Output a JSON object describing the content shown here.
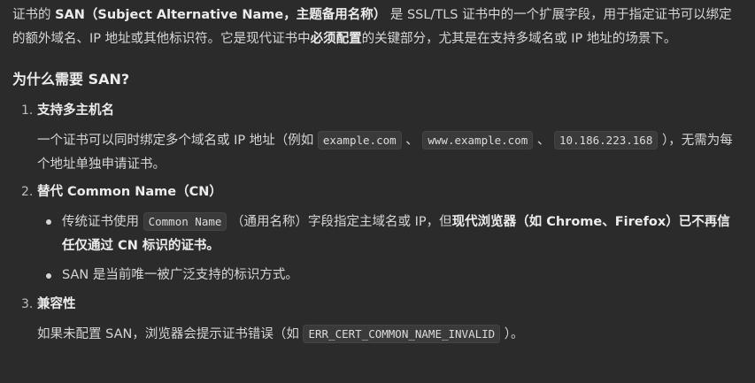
{
  "intro": {
    "p1": "证书的 ",
    "b1": "SAN（Subject Alternative Name，主题备用名称）",
    "p2": " 是 SSL/TLS 证书中的一个扩展字段，用于指定证书可以绑定的额外域名、IP 地址或其他标识符。它是现代证书中",
    "b2": "必须配置",
    "p3": "的关键部分，尤其是在支持多域名或 IP 地址的场景下。"
  },
  "heading": "为什么需要 SAN?",
  "items": [
    {
      "num": "1.",
      "title": "支持多主机名",
      "body": {
        "t1": "一个证书可以同时绑定多个域名或 IP 地址（例如 ",
        "c1": "example.com",
        "t2": " 、 ",
        "c2": "www.example.com",
        "t3": " 、 ",
        "c3": "10.186.223.168",
        "t4": " ），无需为每个地址单独申请证书。"
      }
    },
    {
      "num": "2.",
      "title": "替代 Common Name（CN）",
      "bullets": {
        "b1": {
          "t1": "传统证书使用 ",
          "c1": "Common Name",
          "t2": " （通用名称）字段指定主域名或 IP，但",
          "s1": "现代浏览器（如 Chrome、Firefox）已不再信任仅通过 CN 标识的证书。"
        },
        "b2": {
          "t1": "SAN 是当前唯一被广泛支持的标识方式。"
        }
      }
    },
    {
      "num": "3.",
      "title": "兼容性",
      "body": {
        "t1": "如果未配置 SAN，浏览器会提示证书错误（如 ",
        "c1": "ERR_CERT_COMMON_NAME_INVALID",
        "t2": " ）。"
      }
    }
  ]
}
